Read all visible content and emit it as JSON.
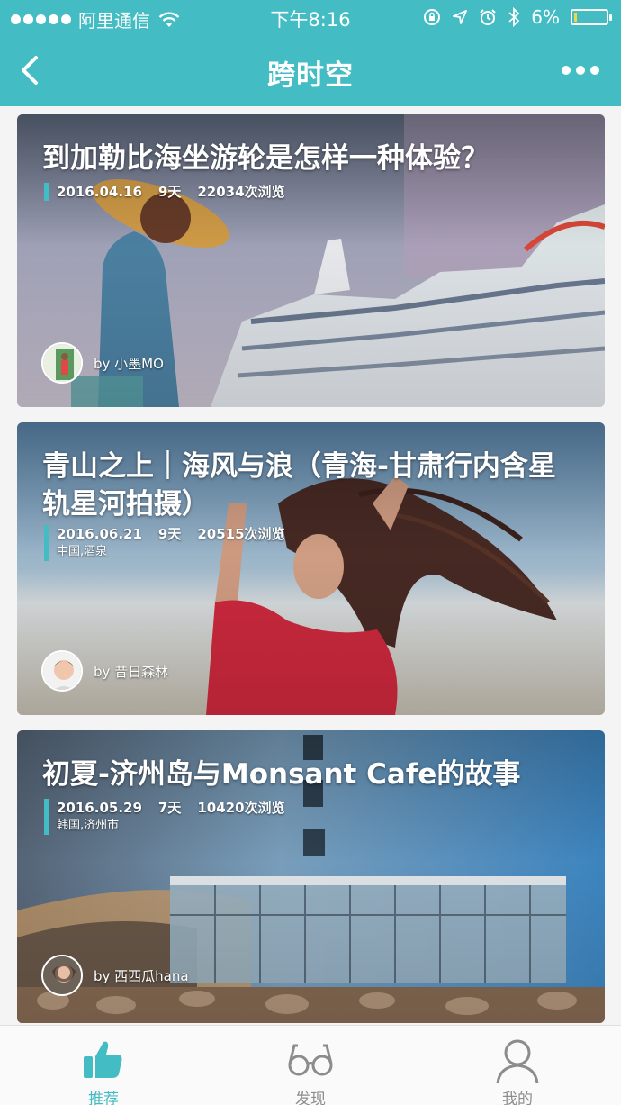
{
  "status_bar": {
    "carrier": "阿里通信",
    "time": "下午8:16",
    "battery_percent": "6%",
    "battery_level": 0.06,
    "icons": [
      "wifi-icon",
      "lock-rotation-icon",
      "location-icon",
      "alarm-icon",
      "bluetooth-icon",
      "battery-icon"
    ]
  },
  "header": {
    "title": "跨时空",
    "back_icon": "chevron-left-icon",
    "more_icon": "more-dots-icon"
  },
  "cards": [
    {
      "title": "到加勒比海坐游轮是怎样一种体验？",
      "date": "2016.04.16",
      "days": "9天",
      "views": "22034次浏览",
      "location": "",
      "author": "by 小墨MO"
    },
    {
      "title": "青山之上｜海风与浪（青海-甘肃行内含星轨星河拍摄）",
      "date": "2016.06.21",
      "days": "9天",
      "views": "20515次浏览",
      "location": "中国,酒泉",
      "author": "by 昔日森林"
    },
    {
      "title": "初夏-济州岛与Monsant Cafe的故事",
      "date": "2016.05.29",
      "days": "7天",
      "views": "10420次浏览",
      "location": "韩国,济州市",
      "author": "by 西西瓜hana"
    }
  ],
  "tabs": [
    {
      "label": "推荐",
      "icon": "thumbs-up-icon",
      "active": true
    },
    {
      "label": "发现",
      "icon": "glasses-icon",
      "active": false
    },
    {
      "label": "我的",
      "icon": "person-icon",
      "active": false
    }
  ],
  "colors": {
    "accent": "#44bcc4",
    "tab_inactive": "#8c8c8c",
    "page_bg": "#f4f4f4"
  }
}
